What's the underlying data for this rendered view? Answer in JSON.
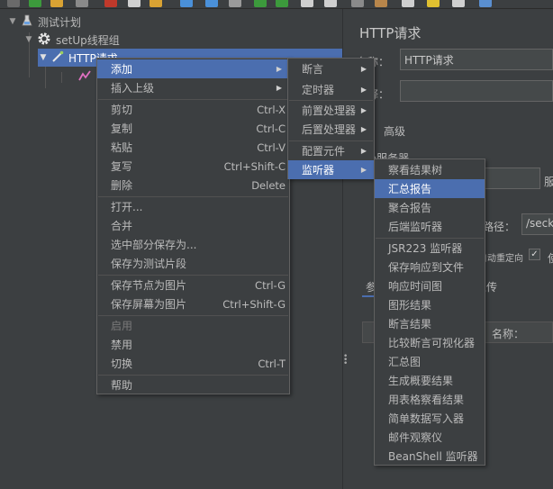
{
  "tree": {
    "nodes": [
      {
        "label": "测试计划",
        "icon": "test-plan-icon"
      },
      {
        "label": "setUp线程组",
        "icon": "gear-icon"
      },
      {
        "label": "HTTP请求",
        "icon": "pipette-icon"
      }
    ]
  },
  "right": {
    "title": "HTTP请求",
    "name_label": "名称：",
    "name_value": "HTTP请求",
    "comment_label": "注释：",
    "advanced_tab": "高级",
    "server_section": "Web服务器",
    "path_label": "路径：",
    "path_value": "/seck",
    "redirect_label": "自动重定向",
    "params_tab": "参数",
    "upload_tab": "文件上传",
    "table_header_name": "名称："
  },
  "menu_main": {
    "items": [
      {
        "label": "添加",
        "accel": "",
        "submenu": true,
        "highlighted": true
      },
      {
        "label": "插入上级",
        "accel": "",
        "submenu": true
      },
      {
        "sep": true
      },
      {
        "label": "剪切",
        "accel": "Ctrl-X"
      },
      {
        "label": "复制",
        "accel": "Ctrl-C"
      },
      {
        "label": "粘贴",
        "accel": "Ctrl-V"
      },
      {
        "label": "复写",
        "accel": "Ctrl+Shift-C"
      },
      {
        "label": "删除",
        "accel": "Delete"
      },
      {
        "sep": true
      },
      {
        "label": "打开...",
        "accel": ""
      },
      {
        "label": "合并",
        "accel": ""
      },
      {
        "label": "选中部分保存为...",
        "accel": ""
      },
      {
        "label": "保存为测试片段",
        "accel": ""
      },
      {
        "sep": true
      },
      {
        "label": "保存节点为图片",
        "accel": "Ctrl-G"
      },
      {
        "label": "保存屏幕为图片",
        "accel": "Ctrl+Shift-G"
      },
      {
        "sep": true
      },
      {
        "label": "启用",
        "accel": "",
        "disabled": true
      },
      {
        "label": "禁用",
        "accel": ""
      },
      {
        "label": "切换",
        "accel": "Ctrl-T"
      },
      {
        "sep": true
      },
      {
        "label": "帮助",
        "accel": ""
      }
    ]
  },
  "menu_add": {
    "items": [
      {
        "label": "断言",
        "submenu": true
      },
      {
        "label": "定时器",
        "submenu": true
      },
      {
        "sep": true
      },
      {
        "label": "前置处理器",
        "submenu": true
      },
      {
        "label": "后置处理器",
        "submenu": true
      },
      {
        "sep": true
      },
      {
        "label": "配置元件",
        "submenu": true
      },
      {
        "label": "监听器",
        "submenu": true,
        "highlighted": true
      }
    ]
  },
  "menu_listeners": {
    "items": [
      {
        "label": "察看结果树"
      },
      {
        "label": "汇总报告",
        "highlighted": true
      },
      {
        "label": "聚合报告"
      },
      {
        "label": "后端监听器"
      },
      {
        "sep": true
      },
      {
        "label": "JSR223 监听器"
      },
      {
        "label": "保存响应到文件"
      },
      {
        "label": "响应时间图"
      },
      {
        "label": "图形结果"
      },
      {
        "label": "断言结果"
      },
      {
        "label": "比较断言可视化器"
      },
      {
        "label": "汇总图"
      },
      {
        "label": "生成概要结果"
      },
      {
        "label": "用表格察看结果"
      },
      {
        "label": "简单数据写入器"
      },
      {
        "label": "邮件观察仪"
      },
      {
        "label": "BeanShell 监听器"
      }
    ]
  },
  "colors": {
    "background": "#3c3f41",
    "highlight": "#4b6eaf",
    "text": "#bbbbbb",
    "disabled_text": "#7a7a7a"
  }
}
